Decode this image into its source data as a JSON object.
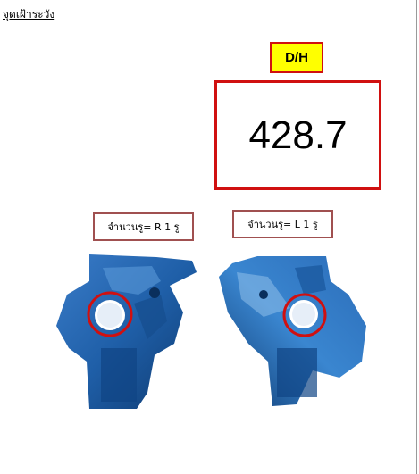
{
  "heading": "จุดเฝ้าระวัง",
  "measurement": {
    "label": "D/H",
    "value": "428.7"
  },
  "parts": [
    {
      "count_label": "จำนวนรู= R 1 รู",
      "side": "R"
    },
    {
      "count_label": "จำนวนรู= L 1 รู",
      "side": "L"
    }
  ],
  "colors": {
    "highlight_red": "#d01010",
    "label_yellow": "#ffff00",
    "part_blue": "#1f5fa8"
  }
}
